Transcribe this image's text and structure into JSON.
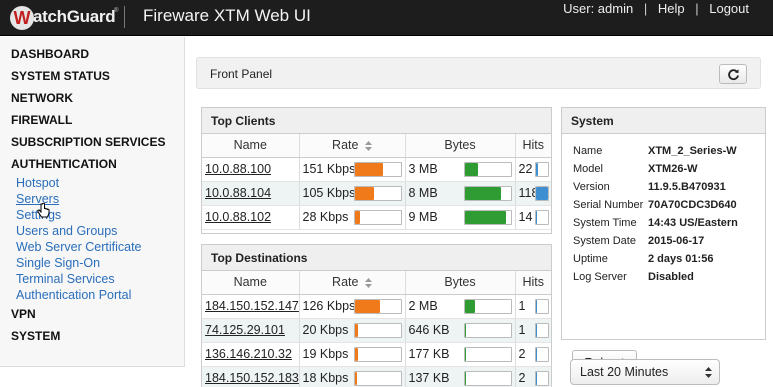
{
  "header": {
    "logo_mark": "W",
    "logo_text": "atchGuard",
    "logo_reg": "®",
    "title": "Fireware XTM Web UI",
    "user_label": "User: admin",
    "separator": "|",
    "help_label": "Help",
    "logout_label": "Logout"
  },
  "sidebar": {
    "items": [
      {
        "label": "DASHBOARD",
        "type": "major"
      },
      {
        "label": "SYSTEM STATUS",
        "type": "major"
      },
      {
        "label": "NETWORK",
        "type": "major"
      },
      {
        "label": "FIREWALL",
        "type": "major"
      },
      {
        "label": "SUBSCRIPTION SERVICES",
        "type": "major"
      },
      {
        "label": "AUTHENTICATION",
        "type": "major"
      },
      {
        "label": "Hotspot",
        "type": "minor"
      },
      {
        "label": "Servers",
        "type": "minor"
      },
      {
        "label": "Settings",
        "type": "minor"
      },
      {
        "label": "Users and Groups",
        "type": "minor"
      },
      {
        "label": "Web Server Certificate",
        "type": "minor"
      },
      {
        "label": "Single Sign-On",
        "type": "minor"
      },
      {
        "label": "Terminal Services",
        "type": "minor"
      },
      {
        "label": "Authentication Portal",
        "type": "minor"
      },
      {
        "label": "VPN",
        "type": "major"
      },
      {
        "label": "SYSTEM",
        "type": "major"
      }
    ]
  },
  "front_panel": {
    "title": "Front Panel"
  },
  "top_clients": {
    "title": "Top Clients",
    "columns": [
      "Name",
      "Rate",
      "Bytes",
      "Hits"
    ],
    "rows": [
      {
        "name": "10.0.88.100",
        "rate": "151 Kbps",
        "rate_level": 0.62,
        "bytes": "3 MB",
        "bytes_level": 0.3,
        "hits": "22",
        "hits_level": 0.2
      },
      {
        "name": "10.0.88.104",
        "rate": "105 Kbps",
        "rate_level": 0.43,
        "bytes": "8 MB",
        "bytes_level": 0.8,
        "hits": "118",
        "hits_level": 1.0
      },
      {
        "name": "10.0.88.102",
        "rate": "28 Kbps",
        "rate_level": 0.12,
        "bytes": "9 MB",
        "bytes_level": 0.9,
        "hits": "14",
        "hits_level": 0.13
      }
    ]
  },
  "top_destinations": {
    "title": "Top Destinations",
    "columns": [
      "Name",
      "Rate",
      "Bytes",
      "Hits"
    ],
    "rows": [
      {
        "name": "184.150.152.147",
        "rate": "126 Kbps",
        "rate_level": 0.55,
        "bytes": "2 MB",
        "bytes_level": 0.22,
        "hits": "1",
        "hits_level": 0.05
      },
      {
        "name": "74.125.29.101",
        "rate": "20 Kbps",
        "rate_level": 0.07,
        "bytes": "646 KB",
        "bytes_level": 0.04,
        "hits": "1",
        "hits_level": 0.05
      },
      {
        "name": "136.146.210.32",
        "rate": "19 Kbps",
        "rate_level": 0.07,
        "bytes": "177 KB",
        "bytes_level": 0.03,
        "hits": "2",
        "hits_level": 0.1
      },
      {
        "name": "184.150.152.183",
        "rate": "18 Kbps",
        "rate_level": 0.06,
        "bytes": "137 KB",
        "bytes_level": 0.02,
        "hits": "2",
        "hits_level": 0.1
      }
    ]
  },
  "system": {
    "title": "System",
    "rows": [
      {
        "key": "Name",
        "value": "XTM_2_Series-W"
      },
      {
        "key": "Model",
        "value": "XTM26-W"
      },
      {
        "key": "Version",
        "value": "11.9.5.B470931"
      },
      {
        "key": "Serial Number",
        "value": "70A70CDC3D640"
      },
      {
        "key": "System Time",
        "value": "14:43 US/Eastern"
      },
      {
        "key": "System Date",
        "value": "2015-06-17"
      },
      {
        "key": "Uptime",
        "value": "2 days 01:56"
      },
      {
        "key": "Log Server",
        "value": "Disabled"
      }
    ],
    "reboot_label": "Reboot"
  },
  "time_range": {
    "selected": "Last 20 Minutes"
  },
  "colors": {
    "rate_bar": "#f07a1a",
    "bytes_bar": "#2e9b33",
    "hits_bar": "#3d8fd1",
    "header_bg": "#1d1d1d",
    "link": "#2a6ebb"
  }
}
